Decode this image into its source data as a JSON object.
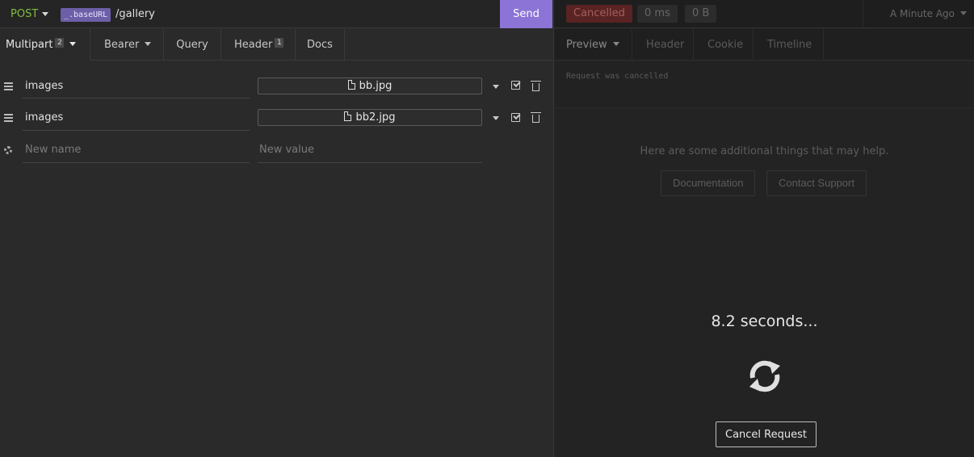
{
  "request": {
    "method": "POST",
    "variable_tag": "_.baseURL",
    "path": "/gallery",
    "send_label": "Send"
  },
  "body_tabs": {
    "multipart": {
      "label": "Multipart",
      "badge": "2"
    },
    "bearer": {
      "label": "Bearer"
    },
    "query": {
      "label": "Query"
    },
    "header": {
      "label": "Header",
      "badge": "1"
    },
    "docs": {
      "label": "Docs"
    }
  },
  "form_rows": [
    {
      "name": "images",
      "file": "bb.jpg"
    },
    {
      "name": "images",
      "file": "bb2.jpg"
    }
  ],
  "new_row": {
    "name_placeholder": "New name",
    "value_placeholder": "New value"
  },
  "response": {
    "status": "Cancelled",
    "time": "0 ms",
    "size": "0 B",
    "history": "A Minute Ago",
    "tabs": {
      "preview": "Preview",
      "header": "Header",
      "cookie": "Cookie",
      "timeline": "Timeline"
    },
    "preview_message": "Request was cancelled",
    "help_text": "Here are some additional things that may help.",
    "documentation_label": "Documentation",
    "support_label": "Contact Support",
    "elapsed": "8.2 seconds...",
    "cancel_label": "Cancel Request"
  },
  "colors": {
    "accent": "#8b74d6",
    "method": "#7fbf3f",
    "cancelled": "#5a2323"
  },
  "icons": [
    "hamburger-icon",
    "file-icon",
    "chevron-down-icon",
    "checkbox-icon",
    "trash-icon",
    "gear-icon",
    "refresh-icon"
  ]
}
